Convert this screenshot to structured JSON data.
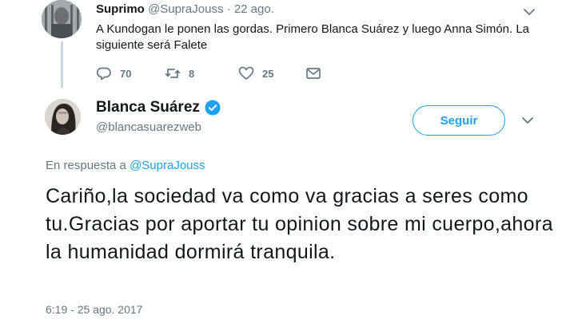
{
  "reply_tweet": {
    "author_name": "Suprimo",
    "author_handle": "@SupraJouss",
    "separator": " · ",
    "date": "22 ago.",
    "text": "A Kundogan le ponen las gordas. Primero Blanca Suárez y luego Anna Simón. La siguiente será Falete",
    "actions": {
      "reply_count": "70",
      "retweet_count": "8",
      "like_count": "25"
    }
  },
  "main_tweet": {
    "author_name": "Blanca Suárez",
    "author_handle": "@blancasuarezweb",
    "follow_label": "Seguir",
    "in_reply_prefix": "En respuesta a ",
    "in_reply_mention": "@SupraJouss",
    "text": "Cariño,la sociedad va como va gracias a seres como tu.Gracias por aportar tu opinion sobre mi cuerpo,ahora la humanidad dormirá tranquila.",
    "timestamp": "6:19 - 25 ago. 2017"
  },
  "colors": {
    "accent": "#1da1f2",
    "text_primary": "#14171a",
    "text_secondary": "#657786",
    "thread_line": "#ccd6dd"
  },
  "icons": {
    "reply": "reply-icon",
    "retweet": "retweet-icon",
    "like": "heart-icon",
    "message": "message-icon",
    "verified": "verified-badge-icon",
    "caret": "chevron-down-icon"
  }
}
